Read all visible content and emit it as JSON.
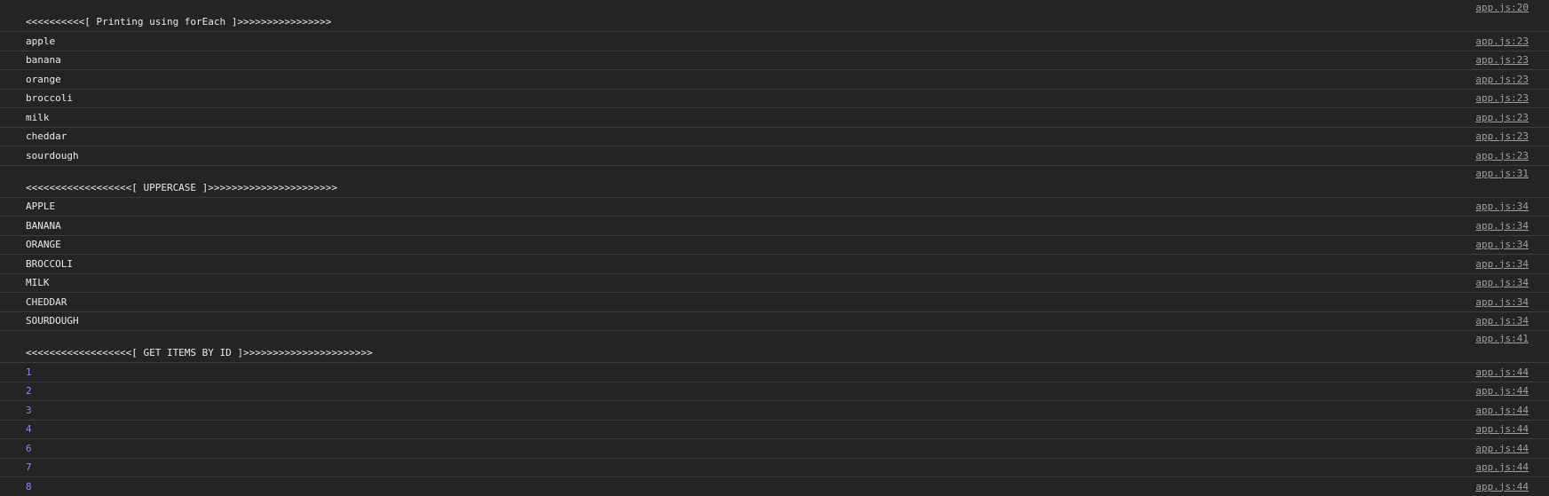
{
  "theme": {
    "background": "#242424",
    "text": "#e8eaed",
    "number": "#9980ff",
    "link": "#9aa0a6",
    "divider": "#3d3d3d"
  },
  "rows": [
    {
      "kind": "header",
      "text": "<<<<<<<<<<[ Printing using forEach ]>>>>>>>>>>>>>>>>",
      "source": "app.js:20"
    },
    {
      "kind": "plain",
      "text": "apple",
      "source": "app.js:23"
    },
    {
      "kind": "plain",
      "text": "banana",
      "source": "app.js:23"
    },
    {
      "kind": "plain",
      "text": "orange",
      "source": "app.js:23"
    },
    {
      "kind": "plain",
      "text": "broccoli",
      "source": "app.js:23"
    },
    {
      "kind": "plain",
      "text": "milk",
      "source": "app.js:23"
    },
    {
      "kind": "plain",
      "text": "cheddar",
      "source": "app.js:23"
    },
    {
      "kind": "plain",
      "text": "sourdough",
      "source": "app.js:23"
    },
    {
      "kind": "header",
      "text": "<<<<<<<<<<<<<<<<<<[ UPPERCASE ]>>>>>>>>>>>>>>>>>>>>>>",
      "source": "app.js:31"
    },
    {
      "kind": "plain",
      "text": "APPLE",
      "source": "app.js:34"
    },
    {
      "kind": "plain",
      "text": "BANANA",
      "source": "app.js:34"
    },
    {
      "kind": "plain",
      "text": "ORANGE",
      "source": "app.js:34"
    },
    {
      "kind": "plain",
      "text": "BROCCOLI",
      "source": "app.js:34"
    },
    {
      "kind": "plain",
      "text": "MILK",
      "source": "app.js:34"
    },
    {
      "kind": "plain",
      "text": "CHEDDAR",
      "source": "app.js:34"
    },
    {
      "kind": "plain",
      "text": "SOURDOUGH",
      "source": "app.js:34"
    },
    {
      "kind": "header",
      "text": "<<<<<<<<<<<<<<<<<<[ GET ITEMS BY ID ]>>>>>>>>>>>>>>>>>>>>>>",
      "source": "app.js:41"
    },
    {
      "kind": "num",
      "text": "1",
      "source": "app.js:44"
    },
    {
      "kind": "num",
      "text": "2",
      "source": "app.js:44"
    },
    {
      "kind": "num",
      "text": "3",
      "source": "app.js:44"
    },
    {
      "kind": "num",
      "text": "4",
      "source": "app.js:44"
    },
    {
      "kind": "num",
      "text": "6",
      "source": "app.js:44"
    },
    {
      "kind": "num",
      "text": "7",
      "source": "app.js:44"
    },
    {
      "kind": "num",
      "text": "8",
      "source": "app.js:44"
    }
  ]
}
